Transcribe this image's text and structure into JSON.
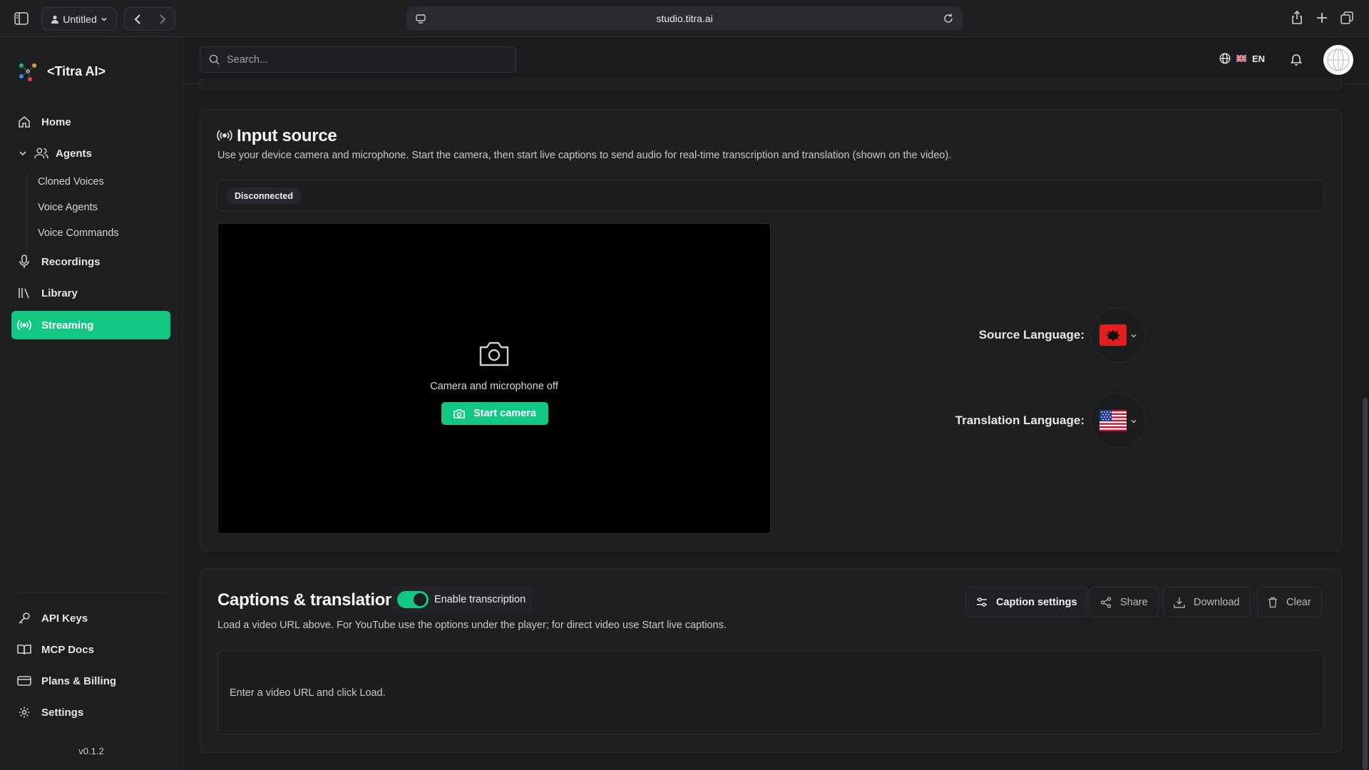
{
  "browser": {
    "profile_label": "Untitled",
    "url": "studio.titra.ai"
  },
  "brand": {
    "name": "<Titra AI>"
  },
  "sidebar": {
    "items": [
      {
        "label": "Home",
        "icon": "home-icon"
      },
      {
        "label": "Agents",
        "icon": "users-icon",
        "expanded": true
      },
      {
        "label": "Recordings",
        "icon": "mic-icon"
      },
      {
        "label": "Library",
        "icon": "library-icon"
      },
      {
        "label": "Streaming",
        "icon": "broadcast-icon",
        "active": true
      }
    ],
    "sub_items": [
      "Cloned Voices",
      "Voice Agents",
      "Voice Commands"
    ],
    "bottom_items": [
      {
        "label": "API Keys",
        "icon": "key-icon"
      },
      {
        "label": "MCP Docs",
        "icon": "book-icon"
      },
      {
        "label": "Plans & Billing",
        "icon": "credit-card-icon"
      },
      {
        "label": "Settings",
        "icon": "gear-icon"
      }
    ],
    "version": "v0.1.2"
  },
  "topbar": {
    "search_placeholder": "Search...",
    "language_code": "EN"
  },
  "input_source": {
    "title": "Input source",
    "description": "Use your device camera and microphone. Start the camera, then start live captions to send audio for real-time transcription and translation (shown on the video).",
    "status": "Disconnected",
    "camera_off_text": "Camera and microphone off",
    "start_camera_label": "Start camera",
    "source_language_label": "Source Language:",
    "translation_language_label": "Translation Language:"
  },
  "captions": {
    "title": "Captions & translation",
    "toggle_label": "Enable transcription",
    "toggle_on": true,
    "description": "Load a video URL above. For YouTube use the options under the player; for direct video use Start live captions.",
    "buttons": {
      "settings": "Caption settings",
      "share": "Share",
      "download": "Download",
      "clear": "Clear"
    },
    "empty_text": "Enter a video URL and click Load."
  },
  "colors": {
    "accent": "#12c784",
    "background": "#1b1c1e",
    "card": "#1e1f21"
  }
}
